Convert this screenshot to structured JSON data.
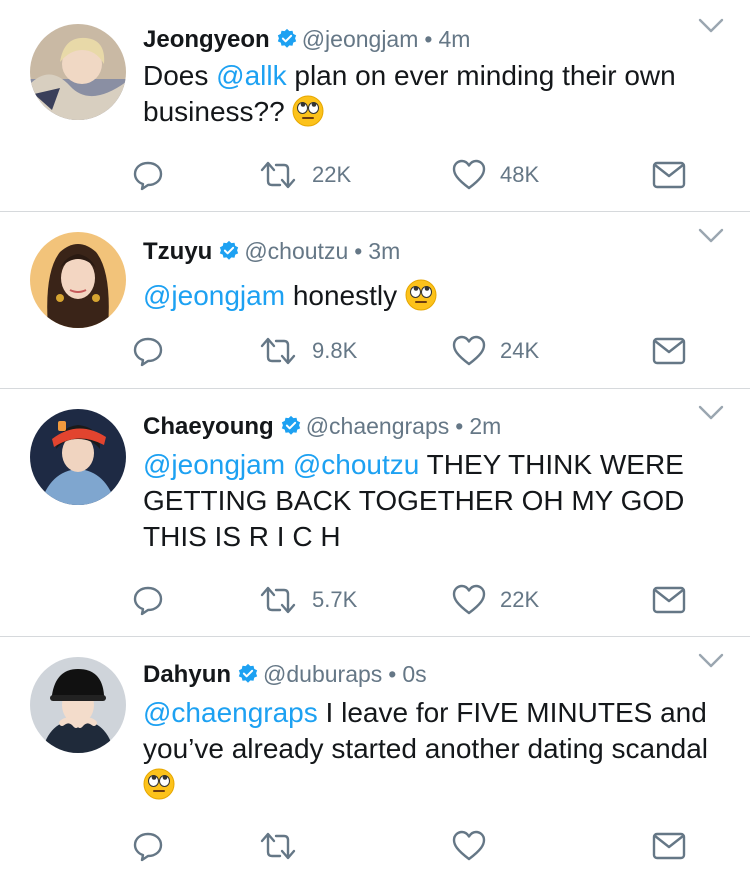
{
  "colors": {
    "text": "#14171a",
    "secondary": "#657786",
    "link": "#1da1f2",
    "verified": "#1da1f2",
    "divider": "#d6d9dc"
  },
  "tweets": [
    {
      "name": "Jeongyeon",
      "handle": "@jeongjam",
      "separator": "•",
      "time": "4m",
      "body": {
        "mention1": "@allk",
        "text1": " plan on ever minding their own business??",
        "prefix": "Does "
      },
      "emoji": "rolling-eyes-emoji",
      "retweets": "22K",
      "likes": "48K"
    },
    {
      "name": "Tzuyu",
      "handle": "@choutzu",
      "separator": "•",
      "time": "3m",
      "body": {
        "mention1": "@jeongjam",
        "text1": " honestly"
      },
      "emoji": "rolling-eyes-emoji",
      "retweets": "9.8K",
      "likes": "24K"
    },
    {
      "name": "Chaeyoung",
      "handle": "@chaengraps",
      "separator": "•",
      "time": "2m",
      "body": {
        "mention1": "@jeongjam",
        "mention2": "@choutzu",
        "text1": " THEY THINK WERE GETTING BACK TOGETHER OH MY GOD THIS IS R I C H"
      },
      "retweets": "5.7K",
      "likes": "22K"
    },
    {
      "name": "Dahyun",
      "handle": "@duburaps",
      "separator": "•",
      "time": "0s",
      "body": {
        "mention1": "@chaengraps",
        "text1": " I leave for FIVE MINUTES and you’ve already started another dating scandal"
      },
      "emoji": "rolling-eyes-emoji",
      "retweets": "",
      "likes": ""
    }
  ]
}
